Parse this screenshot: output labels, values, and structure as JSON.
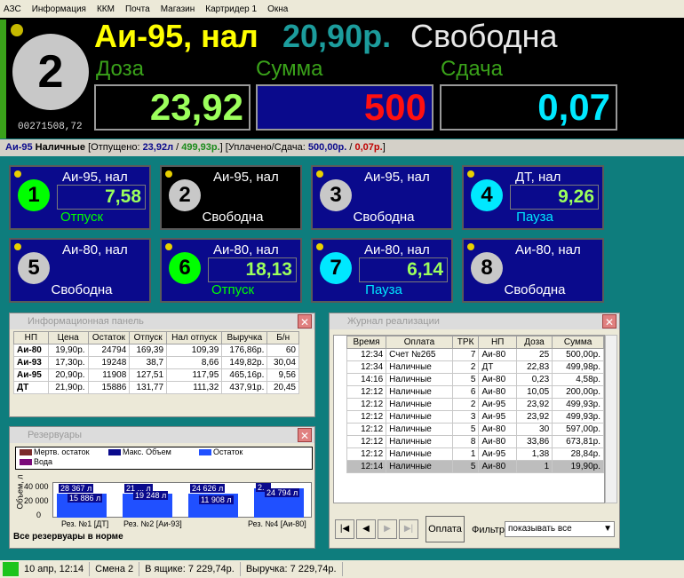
{
  "menu": [
    "АЗС",
    "Информация",
    "ККМ",
    "Почта",
    "Магазин",
    "Картридер 1",
    "Окна"
  ],
  "main": {
    "pump_number": "2",
    "counter": "00271508,72",
    "fuel_label": "Аи-95, нал",
    "price": "20,90р.",
    "status": "Свободна",
    "dose_label": "Доза",
    "sum_label": "Сумма",
    "change_label": "Сдача",
    "dose_value": "23,92",
    "sum_value": "500",
    "change_value": "0,07"
  },
  "infoline": {
    "fuel": "Аи-95",
    "pay": "Наличные",
    "released_prefix": "[Отпущено:",
    "released": "23,92л",
    "released_sum": "499,93р.",
    "paid_prefix": "[Уплачено/Сдача:",
    "paid": "500,00р.",
    "change": "0,07р."
  },
  "pumps": [
    {
      "num": "1",
      "fuel": "Аи-95, нал",
      "value": "7,58",
      "status": "Отпуск",
      "color": "#00ff00",
      "status_color": "#00ff00"
    },
    {
      "num": "2",
      "fuel": "Аи-95, нал",
      "value": "",
      "status": "Свободна",
      "color": "#c8c8c8",
      "status_color": "#ffffff"
    },
    {
      "num": "3",
      "fuel": "Аи-95, нал",
      "value": "",
      "status": "Свободна",
      "color": "#c8c8c8",
      "status_color": "#ffffff"
    },
    {
      "num": "4",
      "fuel": "ДТ, нал",
      "value": "9,26",
      "status": "Пауза",
      "color": "#00e8ff",
      "status_color": "#00e8ff"
    },
    {
      "num": "5",
      "fuel": "Аи-80, нал",
      "value": "",
      "status": "Свободна",
      "color": "#c8c8c8",
      "status_color": "#ffffff"
    },
    {
      "num": "6",
      "fuel": "Аи-80, нал",
      "value": "18,13",
      "status": "Отпуск",
      "color": "#00ff00",
      "status_color": "#00ff00"
    },
    {
      "num": "7",
      "fuel": "Аи-80, нал",
      "value": "6,14",
      "status": "Пауза",
      "color": "#00e8ff",
      "status_color": "#00e8ff"
    },
    {
      "num": "8",
      "fuel": "Аи-80, нал",
      "value": "",
      "status": "Свободна",
      "color": "#c8c8c8",
      "status_color": "#ffffff"
    }
  ],
  "info_panel": {
    "title": "Информационная панель",
    "headers": [
      "НП",
      "Цена",
      "Остаток",
      "Отпуск",
      "Нал отпуск",
      "Выручка",
      "Б/н"
    ],
    "rows": [
      [
        "Аи-80",
        "19,90р.",
        "24794",
        "169,39",
        "109,39",
        "176,86р.",
        "60"
      ],
      [
        "Аи-93",
        "17,30р.",
        "19248",
        "38,7",
        "8,66",
        "149,82р.",
        "30,04"
      ],
      [
        "Аи-95",
        "20,90р.",
        "11908",
        "127,51",
        "117,95",
        "465,16р.",
        "9,56"
      ],
      [
        "ДТ",
        "21,90р.",
        "15886",
        "131,77",
        "111,32",
        "437,91р.",
        "20,45"
      ]
    ]
  },
  "reservoirs": {
    "title": "Резервуары",
    "legend": [
      "Мертв. остаток",
      "Макс. Объем",
      "Остаток",
      "Вода"
    ],
    "ylabel": "Объем, л",
    "yticks": [
      "40 000",
      "20 000",
      "0"
    ],
    "bars": [
      {
        "max": "28 367 л",
        "rest": "15 886 л"
      },
      {
        "max": "21 ... л",
        "rest": "19 248 л"
      },
      {
        "max": "24 626 л",
        "rest": "11 908 л"
      },
      {
        "max": "2...",
        "rest": "24 794 л"
      }
    ],
    "xlabels": [
      "Рез. №1 [ДТ]",
      "Рез. №2 [Аи-93]",
      "Рез. №4 [Аи-80]"
    ],
    "footer": "Все резервуары в норме"
  },
  "journal": {
    "title": "Журнал реализации",
    "headers": [
      "Время",
      "Оплата",
      "ТРК",
      "НП",
      "Доза",
      "Сумма"
    ],
    "rows": [
      [
        "12:34",
        "Счет №265",
        "7",
        "Аи-80",
        "25",
        "500,00р."
      ],
      [
        "12:34",
        "Наличные",
        "2",
        "ДТ",
        "22,83",
        "499,98р."
      ],
      [
        "14:16",
        "Наличные",
        "5",
        "Аи-80",
        "0,23",
        "4,58р."
      ],
      [
        "12:12",
        "Наличные",
        "6",
        "Аи-80",
        "10,05",
        "200,00р."
      ],
      [
        "12:12",
        "Наличные",
        "2",
        "Аи-95",
        "23,92",
        "499,93р."
      ],
      [
        "12:12",
        "Наличные",
        "3",
        "Аи-95",
        "23,92",
        "499,93р."
      ],
      [
        "12:12",
        "Наличные",
        "5",
        "Аи-80",
        "30",
        "597,00р."
      ],
      [
        "12:12",
        "Наличные",
        "8",
        "Аи-80",
        "33,86",
        "673,81р."
      ],
      [
        "12:12",
        "Наличные",
        "1",
        "Аи-95",
        "1,38",
        "28,84р."
      ],
      [
        "12:14",
        "Наличные",
        "5",
        "Аи-80",
        "1",
        "19,90р."
      ]
    ],
    "pay_button": "Оплата",
    "filter_label": "Фильтр:",
    "filter_value": "показывать все"
  },
  "statusbar": {
    "datetime": "10 апр, 12:14",
    "shift": "Смена 2",
    "drawer": "В ящике: 7 229,74р.",
    "revenue": "Выручка: 7 229,74р."
  }
}
